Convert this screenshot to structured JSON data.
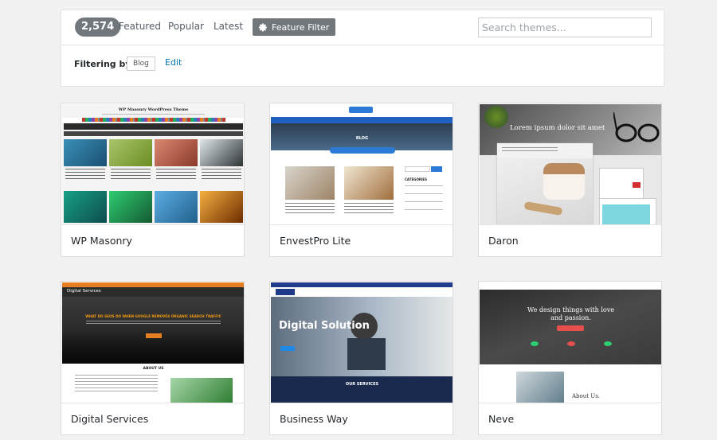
{
  "filter_bar": {
    "count": "2,574",
    "nav": [
      "Featured",
      "Popular",
      "Latest"
    ],
    "feature_filter_label": "Feature Filter",
    "search_placeholder": "Search themes...",
    "filtering_label": "Filtering by:",
    "active_tag": "Blog",
    "edit_label": "Edit"
  },
  "themes": [
    {
      "name": "WP Masonry",
      "preview": {
        "title": "WP Masonry WordPress Theme"
      }
    },
    {
      "name": "EnvestPro Lite",
      "preview": {
        "banner": "BLOG",
        "categories": "CATEGORIES"
      }
    },
    {
      "name": "Daron",
      "preview": {
        "hero": "Lorem ipsum dolor sit amet"
      }
    },
    {
      "name": "Digital Services",
      "preview": {
        "logo": "Digital Services",
        "headline": "WHAT DO SEOS DO WHEN GOOGLE REMOVES ORGANIC SEARCH TRAFFIC",
        "section": "ABOUT US"
      }
    },
    {
      "name": "Business Way",
      "preview": {
        "hero": "Digital Solution",
        "section": "OUR SERVICES"
      }
    },
    {
      "name": "Neve",
      "preview": {
        "hero_line1": "We design things with love",
        "hero_line2": "and passion.",
        "about": "About Us."
      }
    }
  ]
}
